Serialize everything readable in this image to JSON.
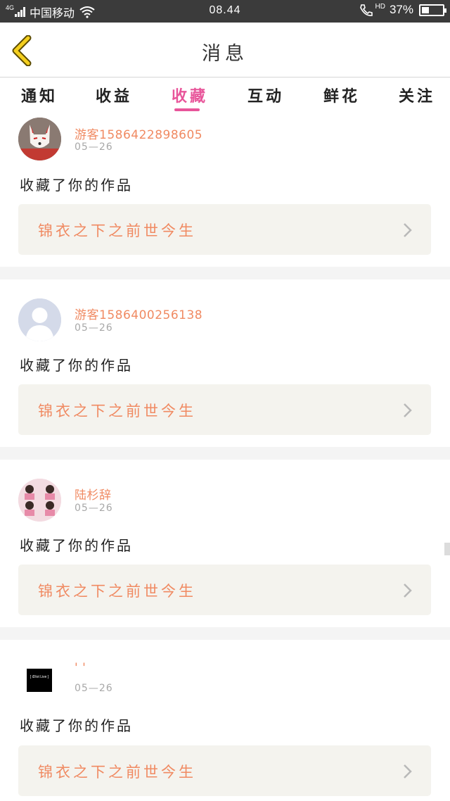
{
  "status_bar": {
    "network": "4G",
    "carrier": "中国移动",
    "time": "08.44",
    "hd": "HD",
    "battery": "37%",
    "battery_level": 0.37,
    "icons": [
      "signal-icon",
      "wifi-icon",
      "phone-hd-icon",
      "battery-icon"
    ]
  },
  "header": {
    "title": "消息",
    "back_icon": "chevron-left-icon"
  },
  "tabs": [
    {
      "label": "通知"
    },
    {
      "label": "收益"
    },
    {
      "label": "收藏",
      "active": true
    },
    {
      "label": "互动"
    },
    {
      "label": "鲜花"
    },
    {
      "label": "关注"
    }
  ],
  "colors": {
    "accent": "#e8559a",
    "username": "#f08a62",
    "link_bg": "#f4f3ee"
  },
  "messages": [
    {
      "username": "游客1586422898605",
      "date": "05—26",
      "action": "收藏了你的作品",
      "work_title": "锦衣之下之前世今生"
    },
    {
      "username": "游客1586400256138",
      "date": "05—26",
      "action": "收藏了你的作品",
      "work_title": "锦衣之下之前世今生"
    },
    {
      "username": "陆杉辞",
      "date": "05—26",
      "action": "收藏了你的作品",
      "work_title": "锦衣之下之前世今生"
    },
    {
      "username": "' '",
      "date": "05—26",
      "action": "收藏了你的作品",
      "work_title": "锦衣之下之前世今生",
      "avatar_text": "[ iDIot Live ]"
    }
  ]
}
